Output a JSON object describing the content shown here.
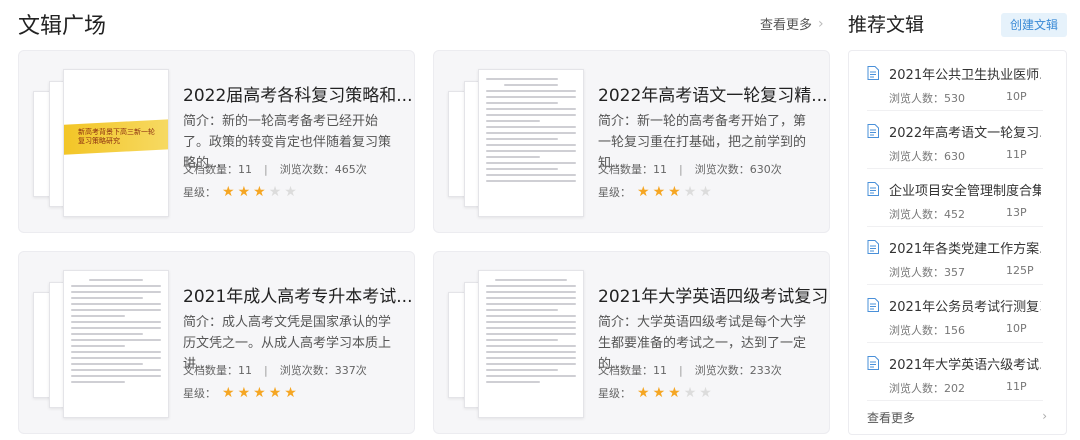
{
  "plaza": {
    "title": "文辑广场",
    "see_more": "查看更多"
  },
  "labels": {
    "summary_prefix": "简介：",
    "doc_count": "文档数量：",
    "view_count": "浏览次数：",
    "rating": "星级："
  },
  "cards": [
    {
      "title": "2022届高考各科复习策略和...",
      "summary": "新的一轮高考备考已经开始了。政策的转变肯定也伴随着复习策略的...",
      "doc_count": "11",
      "views": "465次",
      "rating": 3,
      "thumb_banner": "新高考背景下高三新一轮复习策略研究"
    },
    {
      "title": "2022年高考语文一轮复习精...",
      "summary": "新一轮的高考备考开始了，第一轮复习重在打基础，把之前学到的知...",
      "doc_count": "11",
      "views": "630次",
      "rating": 3
    },
    {
      "title": "2021年成人高考专升本考试...",
      "summary": "成人高考文凭是国家承认的学历文凭之一。从成人高考学习本质上讲...",
      "doc_count": "11",
      "views": "337次",
      "rating": 5
    },
    {
      "title": "2021年大学英语四级考试复习",
      "summary": "大学英语四级考试是每个大学生都要准备的考试之一，达到了一定的...",
      "doc_count": "11",
      "views": "233次",
      "rating": 3
    }
  ],
  "recommend": {
    "title": "推荐文辑",
    "create_label": "创建文辑",
    "views_label": "浏览人数：",
    "see_more": "查看更多",
    "items": [
      {
        "name": "2021年公共卫生执业医师...",
        "views": "530",
        "pages": "10P"
      },
      {
        "name": "2022年高考语文一轮复习...",
        "views": "630",
        "pages": "11P"
      },
      {
        "name": "企业项目安全管理制度合集",
        "views": "452",
        "pages": "13P"
      },
      {
        "name": "2021年各类党建工作方案...",
        "views": "357",
        "pages": "125P"
      },
      {
        "name": "2021年公务员考试行测复习",
        "views": "156",
        "pages": "10P"
      },
      {
        "name": "2021年大学英语六级考试...",
        "views": "202",
        "pages": "11P"
      }
    ]
  },
  "colors": {
    "star_on": "#f5a623",
    "star_off": "#dcdcdc",
    "accent": "#3a8ad6",
    "doc_icon": "#4a90d9"
  }
}
